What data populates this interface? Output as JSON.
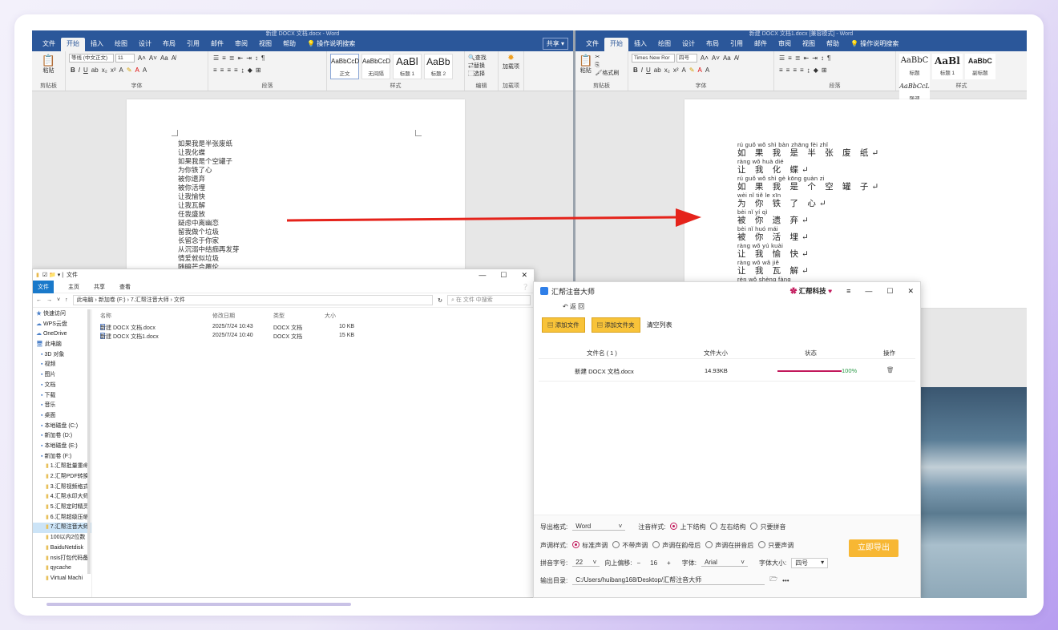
{
  "word_left": {
    "title": "新建 DOCX 文档.docx - Word",
    "tabs": [
      "文件",
      "开始",
      "插入",
      "绘图",
      "设计",
      "布局",
      "引用",
      "邮件",
      "审阅",
      "视图",
      "帮助"
    ],
    "tell_me": "操作说明搜索",
    "share": "共享",
    "font_name": "等线 (中文正文)",
    "font_size": "11",
    "styles": [
      {
        "sample": "AaBbCcD",
        "name": "正文"
      },
      {
        "sample": "AaBbCcD",
        "name": "无间隔"
      },
      {
        "sample": "AaBl",
        "name": "标题 1"
      },
      {
        "sample": "AaBb",
        "name": "标题 2"
      }
    ],
    "groups": {
      "clipboard": "剪贴板",
      "font": "字体",
      "paragraph": "段落",
      "styles": "样式",
      "editing": "编辑",
      "addins": "加载项"
    },
    "paste": "粘贴",
    "find": "查找",
    "replace": "替换",
    "select": "选择",
    "addin": "加载项",
    "poem": [
      "如果我是半张废纸",
      "让我化蝶",
      "如果我是个空罐子",
      "为你铁了心",
      "被你遗弃",
      "被你活埋",
      "让我愉快",
      "让我瓦解",
      "任我盛放",
      "疑虑中离幽恋",
      "留我做个垃圾",
      "长留念于你家",
      "从沉溺中结痂再发芽",
      "情爱就似垃圾",
      "随暗芒合覆伦"
    ]
  },
  "word_right": {
    "title": "新建 DOCX 文档1.docx [兼容模式] - Word",
    "tabs": [
      "文件",
      "开始",
      "插入",
      "绘图",
      "设计",
      "布局",
      "引用",
      "邮件",
      "审阅",
      "视图",
      "帮助"
    ],
    "tell_me": "操作说明搜索",
    "font_name": "Times New Ror",
    "font_size": "四号",
    "format_painter": "格式刷",
    "paste": "粘贴",
    "styles": [
      {
        "sample": "AaBbC",
        "name": "标题"
      },
      {
        "sample": "AaBl",
        "name": "标题 1"
      },
      {
        "sample": "AaBbC",
        "name": "副标题"
      },
      {
        "sample": "AaBbCcL",
        "name": "强调"
      }
    ],
    "groups": {
      "clipboard": "剪贴板",
      "font": "字体",
      "paragraph": "段落",
      "styles": "样式"
    },
    "lines": [
      {
        "py": "rú  guǒ  wǒ  shì  bàn  zhāng  fèi  zhǐ",
        "hz": "如 果 我 是 半  张  废 纸↵"
      },
      {
        "py": "ràng  wǒ  huà  dié",
        "hz": " 让 我 化 蝶↵"
      },
      {
        "py": "rú  guǒ  wǒ  shì  gè  kōng  guàn  zi",
        "hz": "如 果 我 是 个  空   罐  子↵"
      },
      {
        "py": "wèi  nǐ  tiě  le  xīn",
        "hz": "为 你 铁 了 心↵"
      },
      {
        "py": "bèi  nǐ  yí  qì",
        "hz": "被 你 遗 弃↵"
      },
      {
        "py": "bèi  nǐ  huó  mái",
        "hz": "被 你 活 埋↵"
      },
      {
        "py": "ràng  wǒ  yú  kuài",
        "hz": " 让 我 愉 快↵"
      },
      {
        "py": "ràng  wǒ  wǎ  jiě",
        "hz": " 让 我 瓦 解↵"
      },
      {
        "py": "rèn  wǒ  shèng  fàng",
        "hz": ""
      }
    ]
  },
  "explorer": {
    "title": "文件",
    "menu": [
      "文件",
      "主页",
      "共享",
      "查看"
    ],
    "path": "此电脑 › 新加卷 (F:) › 7.汇帮注音大师 › 文件",
    "search_placeholder": "在 文件 中搜索",
    "nav": [
      "快速访问",
      "WPS云盘",
      "OneDrive",
      "此电脑",
      "3D 对象",
      "视频",
      "图片",
      "文档",
      "下载",
      "音乐",
      "桌面",
      "本地磁盘 (C:)",
      "新加卷 (D:)",
      "本地磁盘 (E:)",
      "新加卷 (F:)",
      "1.汇帮批量重命",
      "2.汇帮PDF转换",
      "3.汇帮视频格式",
      "4.汇帮水印大师",
      "5.汇帮定时精灵",
      "6.汇帮超级压缩",
      "7.汇帮注音大师",
      "100以内2位数",
      "BaiduNetdisk",
      "nsis打包代码备",
      "qycache",
      "Virtual Machi"
    ],
    "columns": {
      "name": "名称",
      "date": "修改日期",
      "type": "类型",
      "size": "大小"
    },
    "files": [
      {
        "name": "新建 DOCX 文档.docx",
        "date": "2025/7/24 10:43",
        "type": "DOCX 文档",
        "size": "10 KB"
      },
      {
        "name": "新建 DOCX 文档1.docx",
        "date": "2025/7/24 10:40",
        "type": "DOCX 文档",
        "size": "15 KB"
      }
    ]
  },
  "app": {
    "title": "汇帮注音大师",
    "brand": "汇帮科技",
    "back": "返 回",
    "add_file": "添加文件",
    "add_folder": "添加文件夹",
    "clear_list": "清空列表",
    "columns": {
      "name": "文件名 ( 1 )",
      "size": "文件大小",
      "status": "状态",
      "action": "操作"
    },
    "rows": [
      {
        "name": "新建 DOCX 文档.docx",
        "size": "14.93KB",
        "progress": "100%",
        "progress_value": 1.0
      }
    ],
    "output_format_label": "导出格式:",
    "output_format": "Word",
    "note_style_label": "注音样式:",
    "note_styles": [
      "上下结构",
      "左右结构",
      "只要拼音"
    ],
    "tone_style_label": "声调样式:",
    "tone_styles": [
      "标准声调",
      "不带声调",
      "声调在韵母后",
      "声调在拼音后",
      "只要声调"
    ],
    "pinyin_size_label": "拼音字号:",
    "pinyin_size": "22",
    "offset_label": "向上偏移:",
    "offset_minus": "−",
    "offset": "16",
    "offset_plus": "+",
    "font_label": "字体:",
    "font": "Arial",
    "font_size_label": "字体大小:",
    "font_size": "四号",
    "output_dir_label": "输出目录:",
    "output_dir": "C:/Users/huibang168/Desktop/汇帮注音大师",
    "export": "立即导出",
    "accent": "#c2185b",
    "yellow": "#f8c339"
  }
}
